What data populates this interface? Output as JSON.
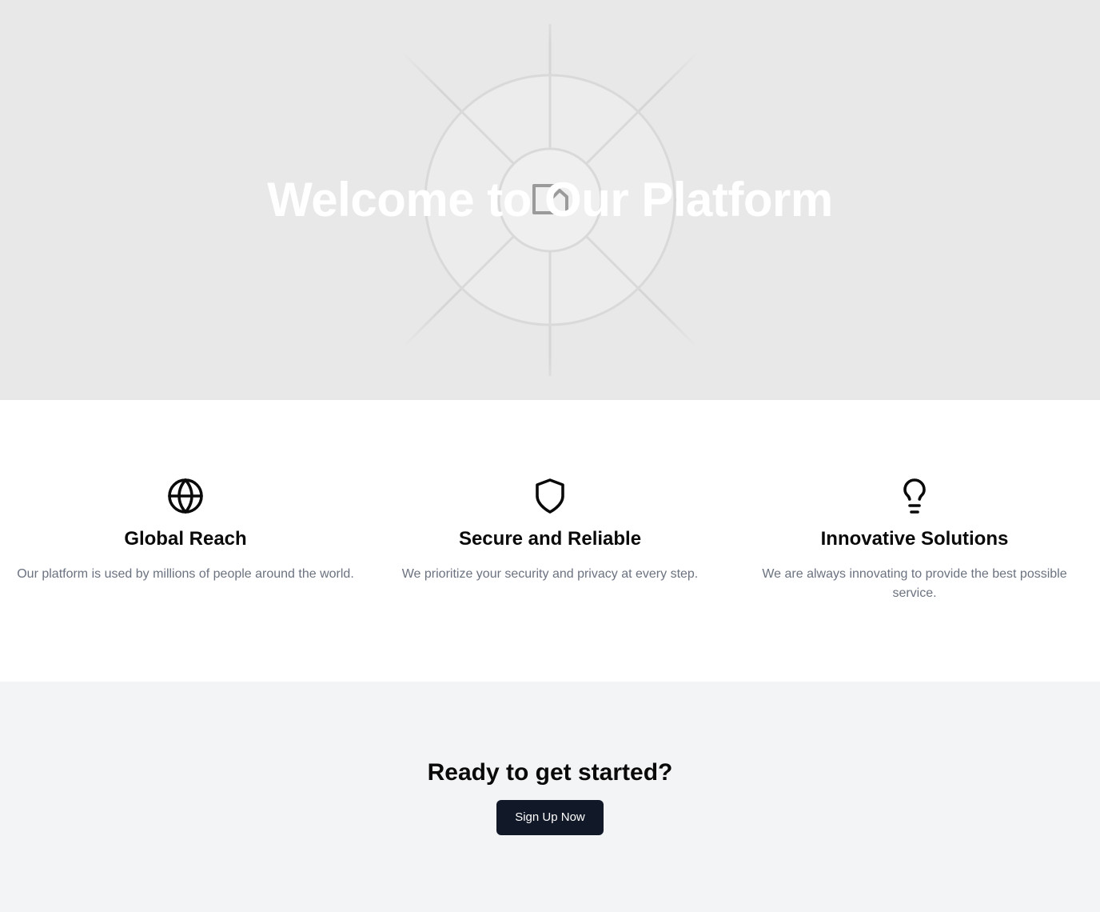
{
  "hero": {
    "title": "Welcome to Our Platform"
  },
  "features": [
    {
      "icon": "globe-icon",
      "title": "Global Reach",
      "description": "Our platform is used by millions of people around the world."
    },
    {
      "icon": "shield-icon",
      "title": "Secure and Reliable",
      "description": "We prioritize your security and privacy at every step."
    },
    {
      "icon": "lightbulb-icon",
      "title": "Innovative Solutions",
      "description": "We are always innovating to provide the best possible service."
    }
  ],
  "cta": {
    "heading": "Ready to get started?",
    "button_label": "Sign Up Now"
  },
  "colors": {
    "hero_background": "#e8e8e8",
    "cta_background": "#f3f4f6",
    "button_background": "#111827",
    "muted_text": "#6b7280"
  }
}
